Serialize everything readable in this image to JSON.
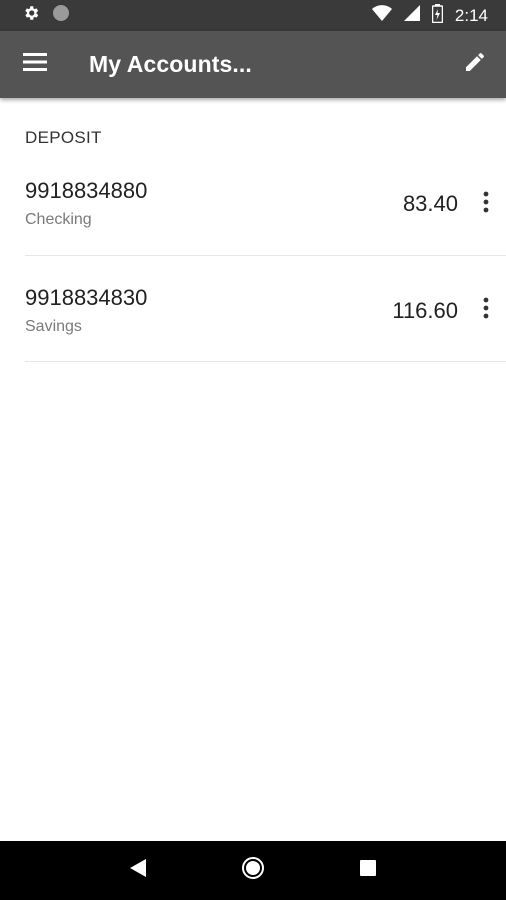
{
  "status_bar": {
    "time": "2:14",
    "icons": [
      "gear-icon",
      "circle-icon",
      "wifi-icon",
      "signal-icon",
      "battery-icon"
    ]
  },
  "app_bar": {
    "title": "My Accounts...",
    "menu_icon": "hamburger-menu-icon",
    "edit_icon": "pencil-icon"
  },
  "section": {
    "header": "DEPOSIT"
  },
  "accounts": [
    {
      "number": "9918834880",
      "type": "Checking",
      "balance": "83.40"
    },
    {
      "number": "9918834830",
      "type": "Savings",
      "balance": "116.60"
    }
  ],
  "nav_bar": {
    "icons": [
      "back-icon",
      "home-icon",
      "recents-icon"
    ]
  },
  "colors": {
    "status_bar": "#3a3a3a",
    "app_bar": "#545454",
    "nav_bar": "#000000",
    "text_primary": "#212121",
    "text_secondary": "#7a7a7a"
  }
}
